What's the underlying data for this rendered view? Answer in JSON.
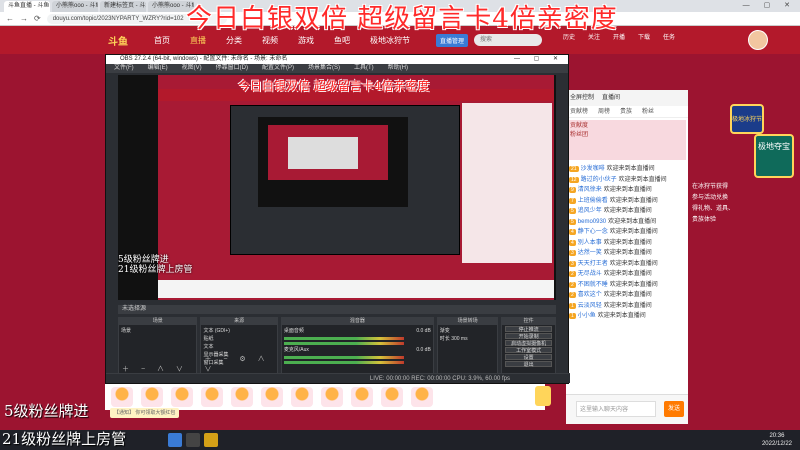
{
  "browser": {
    "tabs": [
      "斗鱼直播 - 斗鱼",
      "小熊熊ooo - 斗鱼",
      "新建标签页 - 斗鱼",
      "小熊熊ooo - 斗鱼"
    ],
    "url": "douyu.com/topic/2023NYPARTY_WZRY?rid=102"
  },
  "overlay": {
    "top": "今日白银双倍  超级留言卡4倍亲密度",
    "bottom_line1": "5级粉丝牌进",
    "bottom_line2": "21级粉丝牌上房管"
  },
  "site": {
    "logo": "斗鱼",
    "nav": [
      "首页",
      "直播",
      "分类",
      "视频",
      "游戏",
      "鱼吧",
      "极地冰狩节"
    ],
    "header_btn": "直播管理",
    "search_placeholder": "搜索",
    "header_icons": [
      "历史",
      "关注",
      "开播",
      "下载",
      "任务"
    ]
  },
  "obs": {
    "title": "OBS 27.2.4 (64-bit, windows) - 配置文件: 未命名 - 场景: 未命名",
    "menu": [
      "文件(F)",
      "编辑(E)",
      "视图(V)",
      "停靠窗口(D)",
      "配置文件(P)",
      "场景集合(S)",
      "工具(T)",
      "帮助(H)"
    ],
    "preview_overlay": "今日白银双倍  超级留言卡4倍亲密度",
    "preview_bottom1": "5级粉丝牌进",
    "preview_bottom2": "21级粉丝牌上房管",
    "source_bar": "未选择源",
    "panels": {
      "scenes": {
        "title": "场景",
        "items": [
          "场景"
        ]
      },
      "sources": {
        "title": "来源",
        "items": [
          "文本 (GDI+)",
          "贴纸",
          "文本",
          "显示器采集",
          "窗口采集"
        ]
      },
      "mixer": {
        "title": "混音器",
        "items": [
          "桌面音频",
          "麦克风/Aux"
        ],
        "db": [
          "0.0 dB",
          "0.0 dB"
        ]
      },
      "transitions": {
        "title": "场景转场",
        "type": "渐变",
        "duration_label": "时长",
        "duration": "300 ms"
      },
      "controls": {
        "title": "控件",
        "buttons": [
          "停止推流",
          "开始录制",
          "启动虚拟摄像机",
          "工作室模式",
          "设置",
          "退出"
        ]
      }
    },
    "status": "LIVE: 00:00:00   REC: 00:00:00   CPU: 3.9%, 60.00 fps"
  },
  "chat": {
    "header": [
      "全屏控制",
      "直播间"
    ],
    "tabs": [
      "贡献榜",
      "周榜",
      "贵族",
      "粉丝"
    ],
    "pink_box": [
      "贡献度",
      "粉丝团"
    ],
    "messages": [
      {
        "fan": "21",
        "name": "沙发咖啡",
        "text": "欢迎来到本直播间"
      },
      {
        "fan": "12",
        "name": "路过的小伙子",
        "text": "欢迎来到本直播间"
      },
      {
        "fan": "9",
        "name": "清风徐来",
        "text": "欢迎来到本直播间"
      },
      {
        "fan": "7",
        "name": "上班偷偷看",
        "text": "欢迎来到本直播间"
      },
      {
        "fan": "5",
        "name": "追风少年",
        "text": "欢迎来到本直播间"
      },
      {
        "fan": "5",
        "name": "bemo0930",
        "text": "欢迎来到本直播间"
      },
      {
        "fan": "4",
        "name": "静下心一念",
        "text": "欢迎来到本直播间"
      },
      {
        "fan": "4",
        "name": "别人本事",
        "text": "欢迎来到本直播间"
      },
      {
        "fan": "3",
        "name": "达然一笑",
        "text": "欢迎来到本直播间"
      },
      {
        "fan": "3",
        "name": "天天打王者",
        "text": "欢迎来到本直播间"
      },
      {
        "fan": "2",
        "name": "无尽战斗",
        "text": "欢迎来到本直播间"
      },
      {
        "fan": "2",
        "name": "不困就不睡",
        "text": "欢迎来到本直播间"
      },
      {
        "fan": "2",
        "name": "喜欢这个",
        "text": "欢迎来到本直播间"
      },
      {
        "fan": "1",
        "name": "云淡风轻",
        "text": "欢迎来到本直播间"
      },
      {
        "fan": "1",
        "name": "小小鱼",
        "text": "欢迎来到本直播间"
      }
    ],
    "input_placeholder": "这里输入聊天内容",
    "send_label": "发送"
  },
  "side_ad": {
    "badge1": "极地冰狩节",
    "badge2": "极地夺宝",
    "lines": [
      "在冰狩节获得",
      "参与活动兑换",
      "得礼物、道具、",
      "贵族体验"
    ]
  },
  "notice": "【通知】 你可领取大额红包",
  "clock": {
    "time": "20:36",
    "date": "2022/12/22"
  }
}
